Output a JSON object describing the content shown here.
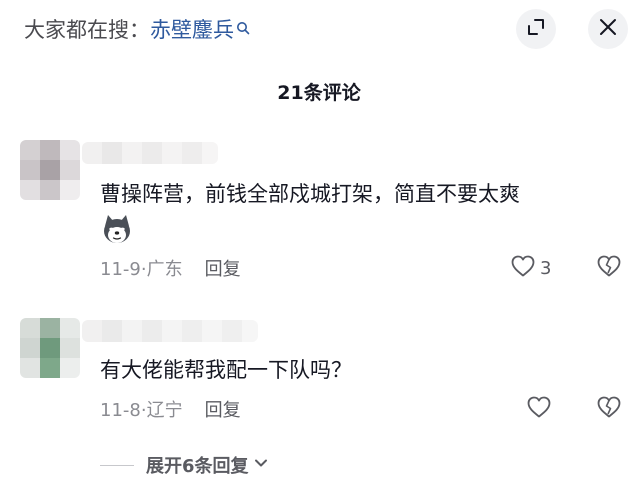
{
  "search": {
    "prefix": "大家都在搜：",
    "keyword": "赤壁鏖兵"
  },
  "header": {
    "title": "21条评论"
  },
  "comments": [
    {
      "text": "曹操阵营，前钱全部戍城打架，简直不要太爽",
      "emoji": "dog-face-emoji",
      "date": "11-9",
      "location": "广东",
      "reply_label": "回复",
      "like_count": "3"
    },
    {
      "text": "有大佬能帮我配一下队吗？",
      "date": "11-8",
      "location": "辽宁",
      "reply_label": "回复",
      "like_count": ""
    }
  ],
  "expand": {
    "label": "展开6条回复"
  },
  "colors": {
    "keyword": "#2f5a9e",
    "meta": "#8a8b91",
    "button_bg": "#f1f2f4"
  }
}
